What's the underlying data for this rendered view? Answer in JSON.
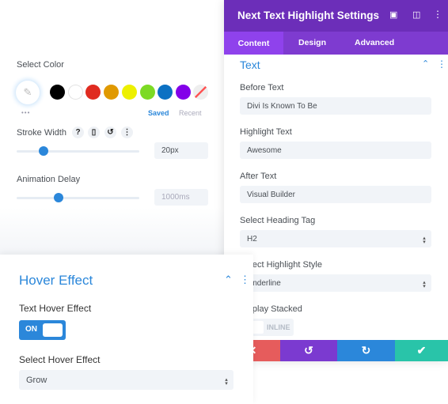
{
  "left_top": {
    "select_color_label": "Select Color",
    "swatches": [
      "#000000",
      "#ffffff",
      "#e02b20",
      "#e09900",
      "#edf000",
      "#7cda24",
      "#0c71c3",
      "#8300e9"
    ],
    "saved_tab": "Saved",
    "recent_tab": "Recent",
    "stroke_width_label": "Stroke Width",
    "stroke_width_value": "20px",
    "stroke_width_slider_percent": 22,
    "animation_delay_label": "Animation Delay",
    "animation_delay_value": "1000ms",
    "animation_delay_slider_percent": 34
  },
  "panel": {
    "title": "Next Text Highlight Settings",
    "tabs": [
      "Content",
      "Design",
      "Advanced"
    ],
    "section_title": "Text",
    "fields": [
      {
        "label": "Before Text",
        "value": "Divi Is Known To Be"
      },
      {
        "label": "Highlight Text",
        "value": "Awesome"
      },
      {
        "label": "After Text",
        "value": "Visual Builder"
      },
      {
        "label": "Select Heading Tag",
        "value": "H2"
      },
      {
        "label": "Select Highlight Style",
        "value": "Underline"
      },
      {
        "label": "Display Stacked",
        "value": "INLINE"
      }
    ],
    "colors": {
      "header": "#6c2eb9",
      "tabs": "#7e3bd0",
      "active_tab": "#8f42ec",
      "cancel": "#e65c5c",
      "undo": "#7b3ad0",
      "redo": "#2b87da",
      "save": "#29c4a9"
    }
  },
  "hover": {
    "title": "Hover Effect",
    "toggle_label": "Text Hover Effect",
    "toggle_value": "ON",
    "select_label": "Select Hover Effect",
    "select_value": "Grow"
  }
}
